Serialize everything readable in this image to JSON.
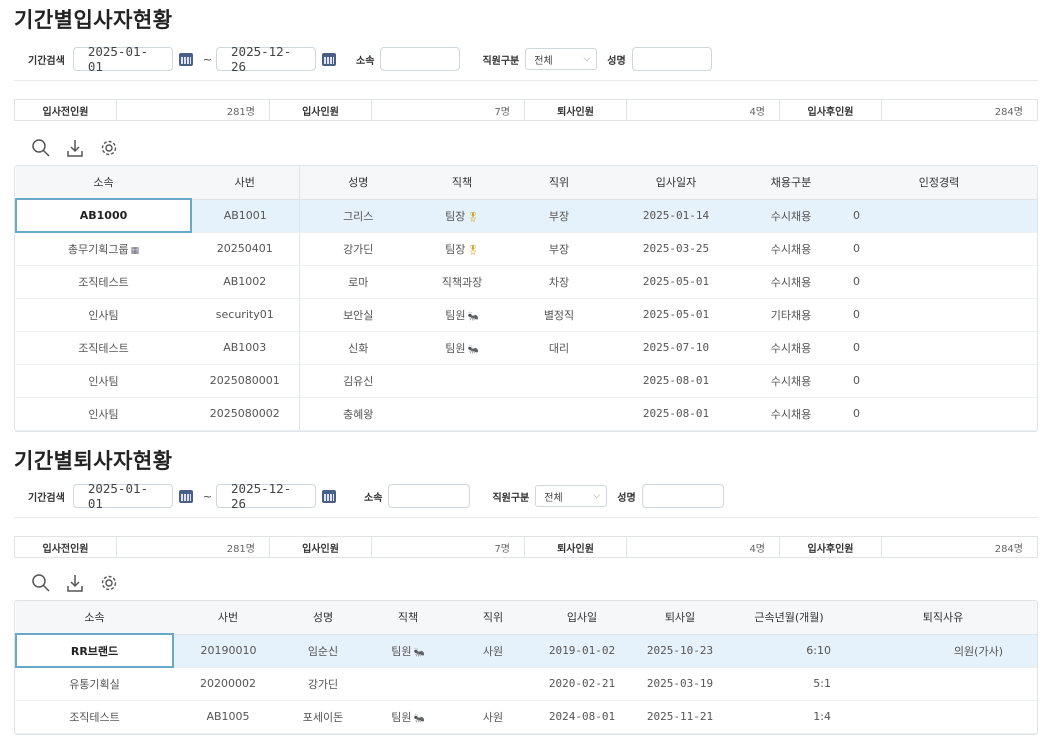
{
  "hire": {
    "title": "기간별입사자현황",
    "search": {
      "period_label": "기간검색",
      "start_date": "2025-01-01",
      "tilde": "~",
      "end_date": "2025-12-26",
      "org_label": "소속",
      "type_label": "직원구분",
      "type_value": "전체",
      "name_label": "성명"
    },
    "summary": [
      {
        "label": "입사전인원",
        "value": "281명"
      },
      {
        "label": "입사인원",
        "value": "7명"
      },
      {
        "label": "퇴사인원",
        "value": "4명"
      },
      {
        "label": "입사후인원",
        "value": "284명"
      }
    ],
    "columns": [
      "소속",
      "사번",
      "성명",
      "직책",
      "직위",
      "입사일자",
      "채용구분",
      "인정경력"
    ],
    "rows": [
      {
        "org": "AB1000",
        "emp": "AB1001",
        "name": "그리스",
        "duty": "팀장",
        "duty_icon": "medal-icon",
        "rank": "부장",
        "date": "2025-01-14",
        "hire_type": "수시채용",
        "career": "0"
      },
      {
        "org": "총무기획그룹",
        "org_icon": "building-icon",
        "emp": "20250401",
        "name": "강가딘",
        "duty": "팀장",
        "duty_icon": "medal-icon",
        "rank": "부장",
        "date": "2025-03-25",
        "hire_type": "수시채용",
        "career": "0"
      },
      {
        "org": "조직테스트",
        "emp": "AB1002",
        "name": "로마",
        "duty": "직책과장",
        "rank": "차장",
        "date": "2025-05-01",
        "hire_type": "수시채용",
        "career": "0"
      },
      {
        "org": "인사팀",
        "emp": "security01",
        "name": "보안실",
        "duty": "팀원",
        "duty_icon": "ant-icon",
        "rank": "별정직",
        "date": "2025-05-01",
        "hire_type": "기타채용",
        "career": "0"
      },
      {
        "org": "조직테스트",
        "emp": "AB1003",
        "name": "신화",
        "duty": "팀원",
        "duty_icon": "ant-icon",
        "rank": "대리",
        "date": "2025-07-10",
        "hire_type": "수시채용",
        "career": "0"
      },
      {
        "org": "인사팀",
        "emp": "2025080001",
        "name": "김유신",
        "duty": "",
        "rank": "",
        "date": "2025-08-01",
        "hire_type": "수시채용",
        "career": "0"
      },
      {
        "org": "인사팀",
        "emp": "2025080002",
        "name": "충혜왕",
        "duty": "",
        "rank": "",
        "date": "2025-08-01",
        "hire_type": "수시채용",
        "career": "0"
      }
    ]
  },
  "resign": {
    "title": "기간별퇴사자현황",
    "search": {
      "period_label": "기간검색",
      "start_date": "2025-01-01",
      "tilde": "~",
      "end_date": "2025-12-26",
      "org_label": "소속",
      "type_label": "직원구분",
      "type_value": "전체",
      "name_label": "성명"
    },
    "summary": [
      {
        "label": "입사전인원",
        "value": "281명"
      },
      {
        "label": "입사인원",
        "value": "7명"
      },
      {
        "label": "퇴사인원",
        "value": "4명"
      },
      {
        "label": "입사후인원",
        "value": "284명"
      }
    ],
    "columns": [
      "소속",
      "사번",
      "성명",
      "직책",
      "직위",
      "입사일",
      "퇴사일",
      "근속년월(개월)",
      "퇴직사유"
    ],
    "rows": [
      {
        "org": "RR브랜드",
        "emp": "20190010",
        "name": "임순신",
        "duty": "팀원",
        "duty_icon": "ant-icon",
        "rank": "사원",
        "join": "2019-01-02",
        "leave": "2025-10-23",
        "tenure": "6:10",
        "reason": "의원(가사)"
      },
      {
        "org": "유통기획실",
        "emp": "20200002",
        "name": "강가딘",
        "duty": "",
        "rank": "",
        "join": "2020-02-21",
        "leave": "2025-03-19",
        "tenure": "5:1",
        "reason": ""
      },
      {
        "org": "조직테스트",
        "emp": "AB1005",
        "name": "포세이돈",
        "duty": "팀원",
        "duty_icon": "ant-icon",
        "rank": "사원",
        "join": "2024-08-01",
        "leave": "2025-11-21",
        "tenure": "1:4",
        "reason": ""
      }
    ]
  },
  "icons": {
    "search": "search-icon",
    "download": "download-icon",
    "settings": "gear-icon",
    "calendar": "calendar-icon",
    "medal": "medal-icon",
    "ant": "ant-icon",
    "building": "building-icon"
  },
  "colors": {
    "selected_row": "#e6f2fb",
    "focus_border": "#68a9c9",
    "calendar_icon": "#4a5f84"
  }
}
